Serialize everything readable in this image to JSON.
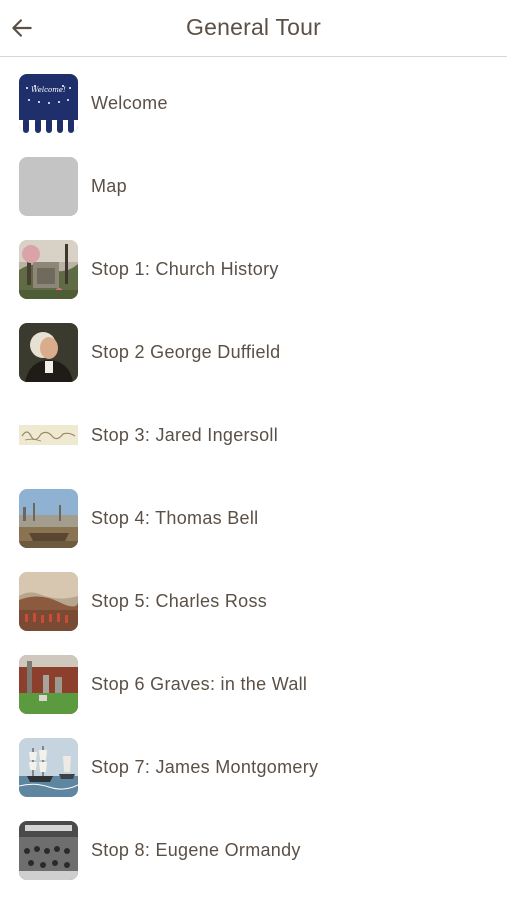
{
  "header": {
    "title": "General Tour",
    "back_icon": "arrow-left-icon"
  },
  "colors": {
    "text": "#5b5046",
    "divider": "#d9d6d2",
    "welcome_blue": "#1f2f6b",
    "placeholder_gray": "#c4c4c4"
  },
  "stops": [
    {
      "label": "Welcome",
      "thumb": "welcome-banner"
    },
    {
      "label": "Map",
      "thumb": "gray-placeholder"
    },
    {
      "label": "Stop 1: Church History",
      "thumb": "churchyard-photo"
    },
    {
      "label": "Stop 2 George Duffield",
      "thumb": "portrait-painting"
    },
    {
      "label": "Stop 3: Jared Ingersoll",
      "thumb": "signature"
    },
    {
      "label": "Stop 4: Thomas Bell",
      "thumb": "harbor-painting"
    },
    {
      "label": "Stop 5: Charles Ross",
      "thumb": "battle-painting"
    },
    {
      "label": "Stop 6 Graves: in the Wall",
      "thumb": "graveyard-photo"
    },
    {
      "label": "Stop 7: James Montgomery",
      "thumb": "ships-painting"
    },
    {
      "label": "Stop 8: Eugene Ormandy",
      "thumb": "orchestra-photo"
    }
  ]
}
